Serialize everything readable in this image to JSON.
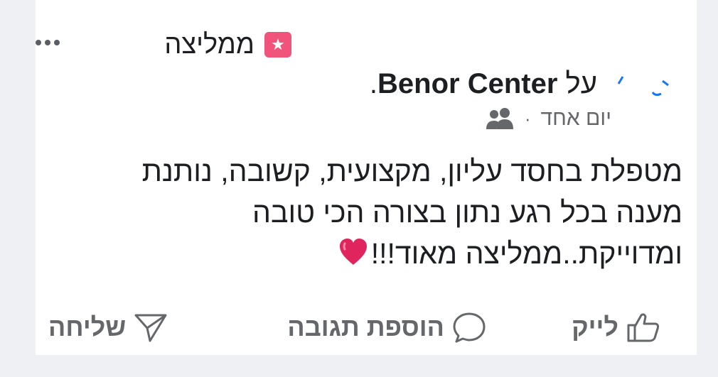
{
  "post": {
    "badge_icon": "star-icon",
    "recommends_label": "ממליצה",
    "review_prefix": "על ",
    "page_name": "Benor Center",
    "review_suffix": ".",
    "time": "יום אחד",
    "separator": "·",
    "audience_icon": "friends-icon",
    "body_lines": [
      "מטפלת בחסד עליון, מקצועית, קשובה, נותנת",
      "מענה בכל רגע נתון בצורה הכי טובה",
      "ומדוייקת..ממליצה מאוד!!!"
    ]
  },
  "actions": {
    "like_label": "לייק",
    "comment_label": "הוספת תגובה",
    "send_label": "שליחה"
  },
  "colors": {
    "badge": "#f0547a",
    "text": "#1c1e21",
    "muted": "#65676b",
    "background": "#eef0f3",
    "card": "#ffffff",
    "heart": "#e0245e"
  }
}
